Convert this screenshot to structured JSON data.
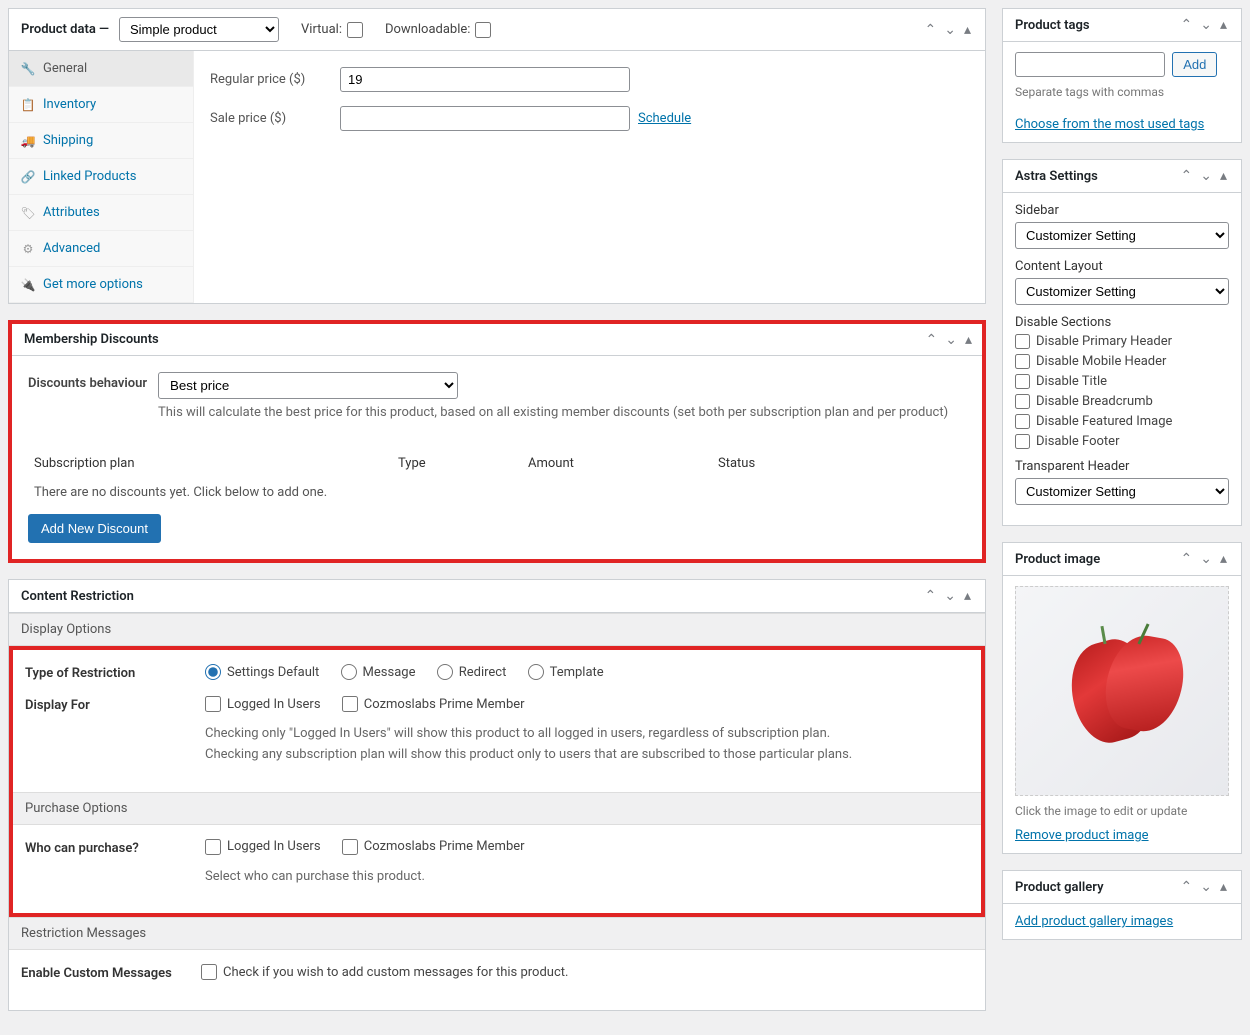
{
  "productData": {
    "title": "Product data —",
    "typeSelect": "Simple product",
    "virtualLabel": "Virtual:",
    "downloadableLabel": "Downloadable:",
    "tabs": {
      "general": "General",
      "inventory": "Inventory",
      "shipping": "Shipping",
      "linked": "Linked Products",
      "attributes": "Attributes",
      "advanced": "Advanced",
      "getmore": "Get more options"
    },
    "regularPriceLabel": "Regular price ($)",
    "regularPriceValue": "19",
    "salePriceLabel": "Sale price ($)",
    "salePriceValue": "",
    "scheduleLink": "Schedule"
  },
  "membership": {
    "title": "Membership Discounts",
    "behaviourLabel": "Discounts behaviour",
    "behaviourValue": "Best price",
    "behaviourDesc": "This will calculate the best price for this product, based on all existing member discounts (set both per subscription plan and per product)",
    "cols": {
      "plan": "Subscription plan",
      "type": "Type",
      "amount": "Amount",
      "status": "Status"
    },
    "emptyText": "There are no discounts yet. Click below to add one.",
    "addBtn": "Add New Discount"
  },
  "restriction": {
    "title": "Content Restriction",
    "displayOptionsHeader": "Display Options",
    "typeLabel": "Type of Restriction",
    "typeOptions": {
      "default": "Settings Default",
      "message": "Message",
      "redirect": "Redirect",
      "template": "Template"
    },
    "displayForLabel": "Display For",
    "displayOptions": {
      "logged": "Logged In Users",
      "cozmos": "Cozmoslabs Prime Member"
    },
    "displayHelp1": "Checking only \"Logged In Users\" will show this product to all logged in users, regardless of subscription plan.",
    "displayHelp2": "Checking any subscription plan will show this product only to users that are subscribed to those particular plans.",
    "purchaseOptionsHeader": "Purchase Options",
    "whoLabel": "Who can purchase?",
    "whoHelp": "Select who can purchase this product.",
    "restrictionMsgsHeader": "Restriction Messages",
    "customMsgsLabel": "Enable Custom Messages",
    "customMsgsHelp": "Check if you wish to add custom messages for this product."
  },
  "tags": {
    "title": "Product tags",
    "addBtn": "Add",
    "separateText": "Separate tags with commas",
    "chooseLink": "Choose from the most used tags"
  },
  "astra": {
    "title": "Astra Settings",
    "sidebarLabel": "Sidebar",
    "sidebarValue": "Customizer Setting",
    "contentLabel": "Content Layout",
    "contentValue": "Customizer Setting",
    "disableLabel": "Disable Sections",
    "disableOptions": {
      "primaryHeader": "Disable Primary Header",
      "mobileHeader": "Disable Mobile Header",
      "title": "Disable Title",
      "breadcrumb": "Disable Breadcrumb",
      "featured": "Disable Featured Image",
      "footer": "Disable Footer"
    },
    "transparentLabel": "Transparent Header",
    "transparentValue": "Customizer Setting"
  },
  "productImage": {
    "title": "Product image",
    "clickText": "Click the image to edit or update",
    "removeLink": "Remove product image"
  },
  "gallery": {
    "title": "Product gallery",
    "addLink": "Add product gallery images"
  }
}
